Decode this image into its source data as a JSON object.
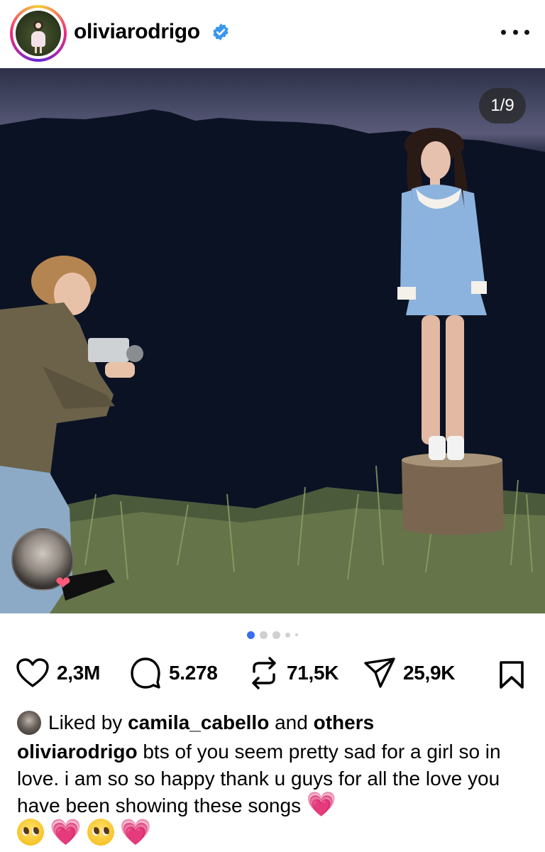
{
  "header": {
    "username": "oliviarodrigo",
    "verified_icon": "verified-badge-icon",
    "more_icon": "more-options-icon"
  },
  "media": {
    "counter": "1/9",
    "carousel_total": 5,
    "carousel_active": 1
  },
  "actions": {
    "likes": "2,3M",
    "comments": "5.278",
    "reposts": "71,5K",
    "shares": "25,9K",
    "icons": [
      "heart-icon",
      "comment-icon",
      "repost-icon",
      "share-icon",
      "bookmark-icon"
    ]
  },
  "liked_by": {
    "prefix": "Liked by",
    "user": "camila_cabello",
    "connector": "and",
    "others": "others"
  },
  "caption": {
    "username": "oliviarodrigo",
    "text": "bts of you seem pretty sad for a girl so in love. i am so so happy thank u guys for all the love you have been showing these songs",
    "emoji_heart": "💗",
    "emoji_pleading": "🥺"
  },
  "colors": {
    "verified_blue": "#3897f0",
    "carousel_active": "#3b6df0",
    "heart_pink": "#e84ec4"
  }
}
